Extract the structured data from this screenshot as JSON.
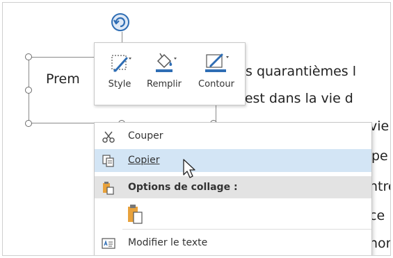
{
  "document": {
    "lines": [
      "s quarantièmes l",
      "'il est dans la vie d",
      "vie",
      "pe",
      "ntre",
      "ce",
      "hor"
    ],
    "shape_text": "Prem"
  },
  "mini_toolbar": {
    "style_label": "Style",
    "fill_label": "Remplir",
    "outline_label": "Contour"
  },
  "context_menu": {
    "cut": "Couper",
    "copy": "Copier",
    "paste_options": "Options de collage :",
    "edit_text": "Modifier le texte"
  },
  "colors": {
    "accent": "#2e6db4",
    "hover": "#d3e5f5",
    "header": "#e3e3e3",
    "paste_orange": "#e8a23c"
  }
}
